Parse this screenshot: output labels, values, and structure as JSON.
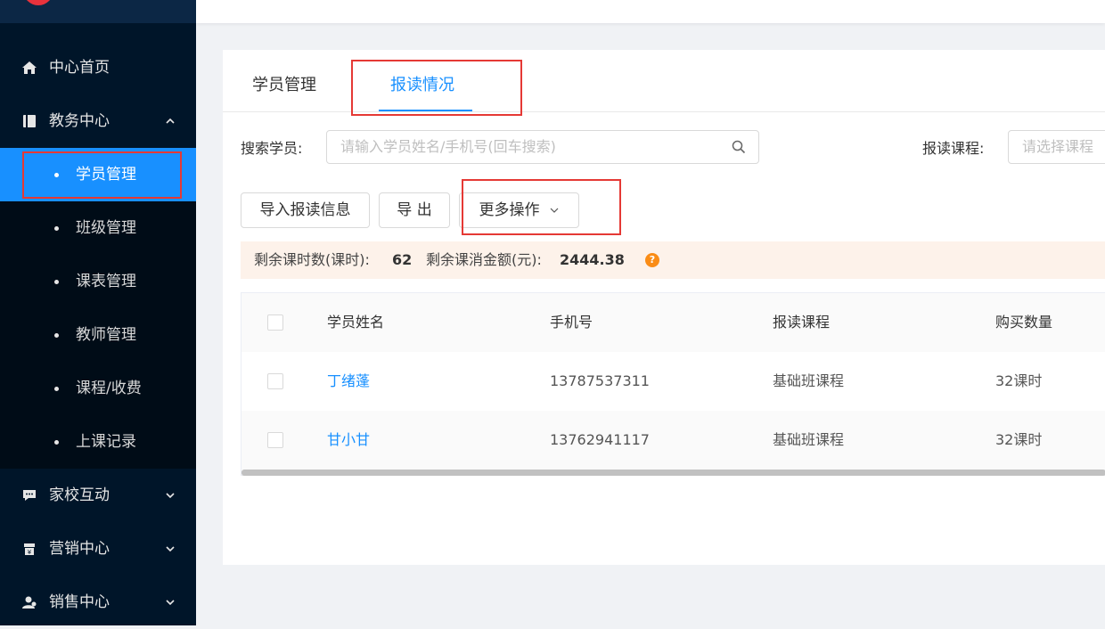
{
  "sidebar": {
    "items": [
      {
        "label": "中心首页",
        "icon": "home-icon"
      },
      {
        "label": "教务中心",
        "icon": "book-icon",
        "expanded": true
      },
      {
        "label": "家校互动",
        "icon": "chat-icon"
      },
      {
        "label": "营销中心",
        "icon": "shop-icon"
      },
      {
        "label": "销售中心",
        "icon": "user-group-icon"
      }
    ],
    "sub_items": [
      {
        "label": "学员管理",
        "active": true
      },
      {
        "label": "班级管理"
      },
      {
        "label": "课表管理"
      },
      {
        "label": "教师管理"
      },
      {
        "label": "课程/收费"
      },
      {
        "label": "上课记录"
      }
    ]
  },
  "tabs": [
    {
      "label": "学员管理"
    },
    {
      "label": "报读情况",
      "active": true
    }
  ],
  "filters": {
    "search_label": "搜索学员:",
    "search_placeholder": "请输入学员姓名/手机号(回车搜索)",
    "course_label": "报读课程:",
    "course_placeholder": "请选择课程"
  },
  "toolbar": {
    "import_label": "导入报读信息",
    "export_label": "导 出",
    "more_label": "更多操作"
  },
  "summary": {
    "hours_label": "剩余课时数(课时):",
    "hours_value": "62",
    "amount_label": "剩余课消金额(元):",
    "amount_value": "2444.38",
    "help_glyph": "?"
  },
  "table": {
    "headers": [
      "学员姓名",
      "手机号",
      "报读课程",
      "购买数量"
    ],
    "rows": [
      {
        "name": "丁绪蓬",
        "phone": "13787537311",
        "course": "基础班课程",
        "quantity": "32课时"
      },
      {
        "name": "甘小甘",
        "phone": "13762941117",
        "course": "基础班课程",
        "quantity": "32课时"
      }
    ]
  },
  "colors": {
    "sidebar_bg": "#001529",
    "accent": "#1890ff",
    "highlight_box": "#e53935",
    "summary_bg": "#fdf2ea",
    "help_icon": "#fa8c16"
  }
}
